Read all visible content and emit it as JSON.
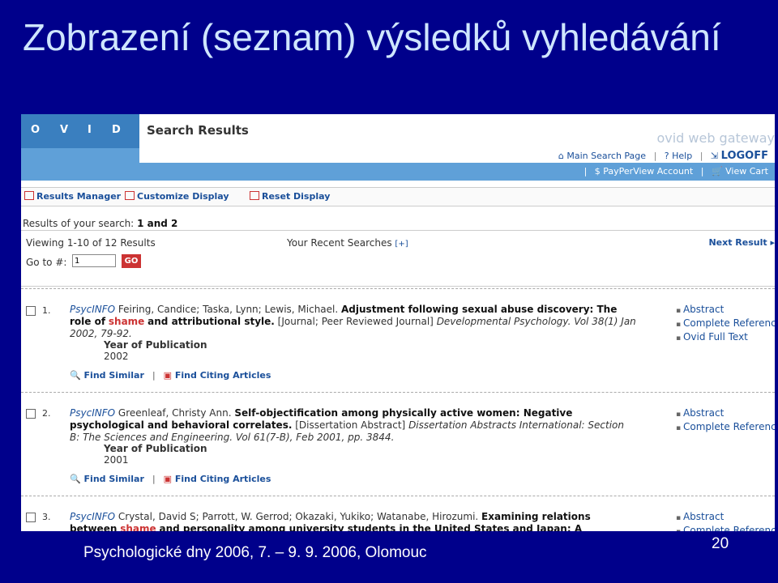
{
  "slide": {
    "title": "Zobrazení (seznam) výsledků vyhledávání",
    "footer": "Psychologické dny 2006, 7. – 9. 9. 2006, Olomouc",
    "page_number": "20"
  },
  "ovid": {
    "logo_letters": [
      "O",
      "V",
      "I",
      "D"
    ],
    "header_title": "Search Results",
    "gateway": "ovid web gateway",
    "nav1": [
      "Main Search Page",
      "Help",
      "LOGOFF"
    ],
    "nav2": [
      "PayPerView Account",
      "View Cart"
    ],
    "toolbar": [
      "Results Manager",
      "Customize Display",
      "Reset Display"
    ],
    "results_of_label": "Results of your search:",
    "results_of_value": "1 and 2",
    "viewing": "Viewing 1-10 of 12 Results",
    "recent_label": "Your Recent Searches",
    "recent_toggle": "[+]",
    "next_result": "Next Result",
    "goto_label": "Go to #:",
    "goto_value": "1",
    "go_button": "GO"
  },
  "results": [
    {
      "number": "1.",
      "db": "PsycINFO",
      "authors": "Feiring, Candice; Taska, Lynn; Lewis, Michael.",
      "title_before": "Adjustment following sexual abuse discovery: The role of",
      "highlight": "shame",
      "title_after": "and attributional style.",
      "pubtype": "[Journal; Peer Reviewed Journal]",
      "source": "Developmental Psychology. Vol 38(1) Jan 2002, 79-92.",
      "year_label": "Year of Publication",
      "year": "2002",
      "find_similar": "Find Similar",
      "find_citing": "Find Citing Articles",
      "side_links": [
        "Abstract",
        "Complete Reference",
        "Ovid Full Text"
      ]
    },
    {
      "number": "2.",
      "db": "PsycINFO",
      "authors": "Greenleaf, Christy Ann.",
      "title_before": "Self-objectification among physically active women: Negative psychological and behavioral correlates.",
      "highlight": "",
      "title_after": "",
      "pubtype": "[Dissertation Abstract]",
      "source": "Dissertation Abstracts International: Section B: The Sciences and Engineering. Vol 61(7-B), Feb 2001, pp. 3844.",
      "year_label": "Year of Publication",
      "year": "2001",
      "find_similar": "Find Similar",
      "find_citing": "Find Citing Articles",
      "side_links": [
        "Abstract",
        "Complete Reference"
      ]
    },
    {
      "number": "3.",
      "db": "PsycINFO",
      "authors": "Crystal, David S; Parrott, W. Gerrod; Okazaki, Yukiko; Watanabe, Hirozumi.",
      "title_before": "Examining relations between",
      "highlight": "shame",
      "title_after": "and personality among university students in the United States and Japan: A",
      "pubtype": "",
      "source": "",
      "year_label": "",
      "year": "",
      "find_similar": "",
      "find_citing": "",
      "side_links": [
        "Abstract",
        "Complete Reference"
      ]
    }
  ]
}
